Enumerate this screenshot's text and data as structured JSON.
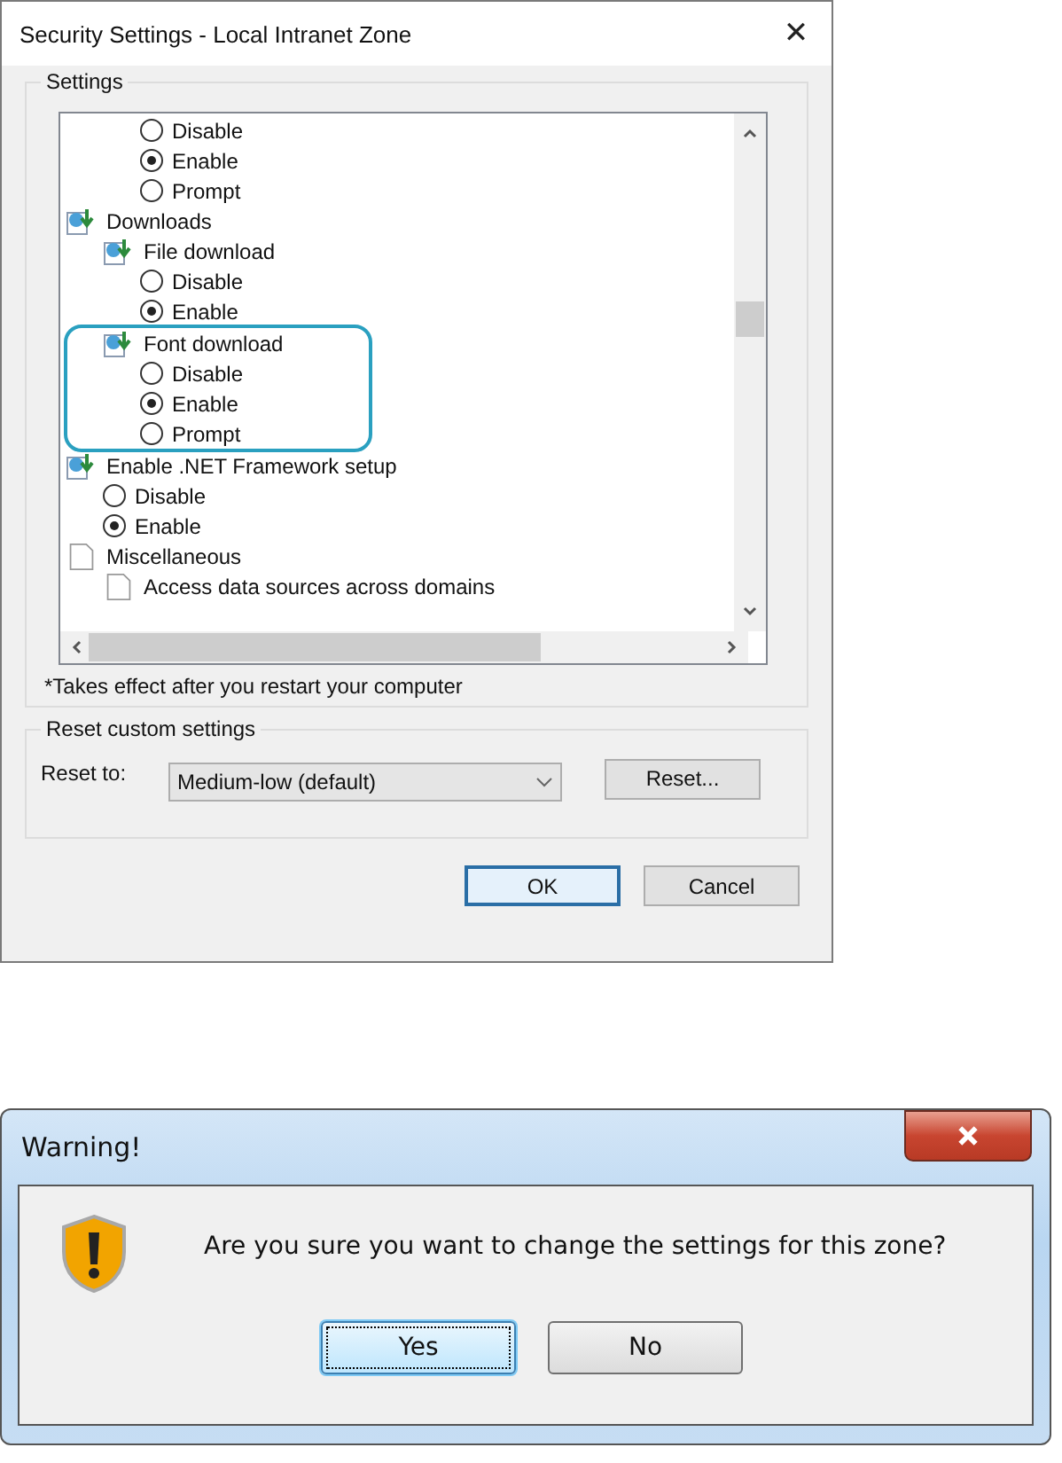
{
  "settings_dialog": {
    "title": "Security Settings - Local Intranet Zone",
    "close": "✕",
    "group_label": "Settings",
    "tree": [
      {
        "kind": "continued",
        "children": [
          {
            "kind": "continued",
            "children": [
              {
                "kind": "radio",
                "label": "Disable",
                "selected": false
              },
              {
                "kind": "radio",
                "label": "Enable",
                "selected": true
              },
              {
                "kind": "radio",
                "label": "Prompt",
                "selected": false
              }
            ]
          }
        ]
      },
      {
        "kind": "folder",
        "label": "Downloads",
        "highlighted": false,
        "children": [
          {
            "kind": "folder",
            "label": "File download",
            "highlighted": false,
            "children": [
              {
                "kind": "radio",
                "label": "Disable",
                "selected": false
              },
              {
                "kind": "radio",
                "label": "Enable",
                "selected": true
              }
            ]
          },
          {
            "kind": "folder",
            "label": "Font download",
            "highlighted": true,
            "children": [
              {
                "kind": "radio",
                "label": "Disable",
                "selected": false
              },
              {
                "kind": "radio",
                "label": "Enable",
                "selected": true
              },
              {
                "kind": "radio",
                "label": "Prompt",
                "selected": false
              }
            ]
          }
        ]
      },
      {
        "kind": "folder",
        "label": "Enable .NET Framework setup",
        "highlighted": false,
        "children": [
          {
            "kind": "radio",
            "label": "Disable",
            "selected": false
          },
          {
            "kind": "radio",
            "label": "Enable",
            "selected": true
          }
        ]
      },
      {
        "kind": "page",
        "label": "Miscellaneous",
        "highlighted": false,
        "children": [
          {
            "kind": "page",
            "label": "Access data sources across domains",
            "highlighted": false
          }
        ]
      }
    ],
    "note": "*Takes effect after you restart your computer",
    "reset_group_label": "Reset custom settings",
    "reset_label": "Reset to:",
    "reset_value": "Medium-low (default)",
    "reset_button": "Reset...",
    "buttons": [
      {
        "label": "OK",
        "default": true
      },
      {
        "label": "Cancel",
        "default": false
      }
    ]
  },
  "warning_dialog": {
    "title": "Warning!",
    "message": "Are you sure you want to change the settings for this zone?",
    "buttons": [
      {
        "label": "Yes",
        "focused": true
      },
      {
        "label": "No",
        "focused": false
      }
    ]
  }
}
